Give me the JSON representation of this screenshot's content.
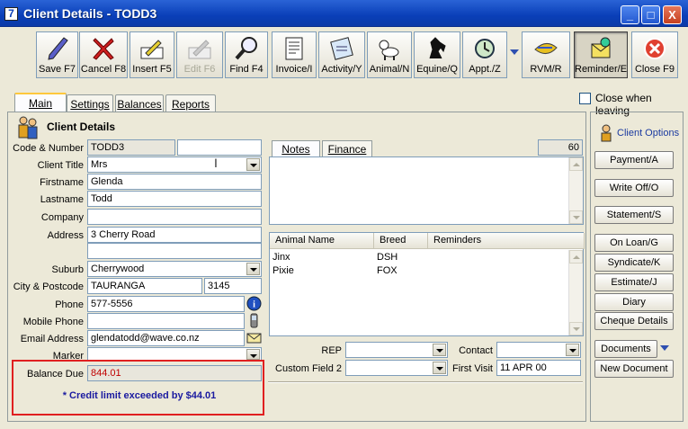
{
  "window": {
    "title": "Client Details - TODD3",
    "app_icon_glyph": "7",
    "controls": {
      "minimize": "_",
      "maximize": "□",
      "close": "X"
    }
  },
  "toolbar": {
    "save": "Save F7",
    "cancel": "Cancel F8",
    "insert": "Insert F5",
    "edit": "Edit F6",
    "find": "Find F4",
    "invoice": "Invoice/I",
    "activity": "Activity/Y",
    "animal": "Animal/N",
    "equine": "Equine/Q",
    "appt": "Appt./Z",
    "rvm": "RVM/R",
    "reminder": "Reminder/E",
    "close": "Close F9"
  },
  "tabs": {
    "main": "Main",
    "settings": "Settings",
    "balances": "Balances",
    "reports": "Reports"
  },
  "close_when_leaving": {
    "label": "Close when leaving",
    "checked": false
  },
  "client": {
    "section_title": "Client Details",
    "code_label": "Code & Number",
    "code_value": "TODD3",
    "number_value": "",
    "title_label": "Client Title",
    "title_value": "Mrs",
    "firstname_label": "Firstname",
    "firstname_value": "Glenda",
    "lastname_label": "Lastname",
    "lastname_value": "Todd",
    "company_label": "Company",
    "company_value": "",
    "address_label": "Address",
    "address_value": "3 Cherry Road",
    "address2_value": "",
    "suburb_label": "Suburb",
    "suburb_value": "Cherrywood",
    "city_label": "City & Postcode",
    "city_value": "TAURANGA",
    "postcode_value": "3145",
    "phone_label": "Phone",
    "phone_value": "577-5556",
    "mobile_label": "Mobile Phone",
    "mobile_value": "",
    "email_label": "Email Address",
    "email_value": "glendatodd@wave.co.nz",
    "marker_label": "Marker",
    "marker_value": "",
    "balance_label": "Balance Due",
    "balance_value": "844.01",
    "credit_alert": "* Credit limit exceeded by $44.01"
  },
  "notes": {
    "tab_notes": "Notes",
    "tab_finance": "Finance",
    "counter": "60",
    "text": ""
  },
  "animals": {
    "columns": [
      "Animal Name",
      "Breed",
      "Reminders"
    ],
    "rows": [
      {
        "name": "Jinx",
        "breed": "DSH",
        "reminders": ""
      },
      {
        "name": "Pixie",
        "breed": "FOX",
        "reminders": ""
      }
    ]
  },
  "extra_fields": {
    "rep_label": "REP",
    "rep_value": "",
    "contact_label": "Contact",
    "contact_value": "",
    "custom2_label": "Custom Field 2",
    "custom2_value": "",
    "first_visit_label": "First Visit",
    "first_visit_value": "11 APR 00"
  },
  "client_options": {
    "title": "Client Options",
    "buttons": [
      "Payment/A",
      "Write Off/O",
      "Statement/S",
      "On Loan/G",
      "Syndicate/K",
      "Estimate/J",
      "Diary",
      "Cheque Details",
      "Documents",
      "New Document"
    ]
  },
  "colors": {
    "title_bar": "#0a3fb8",
    "alert_border": "#e02020",
    "balance_text": "#c00000",
    "alert_text": "#1a1aa0"
  }
}
